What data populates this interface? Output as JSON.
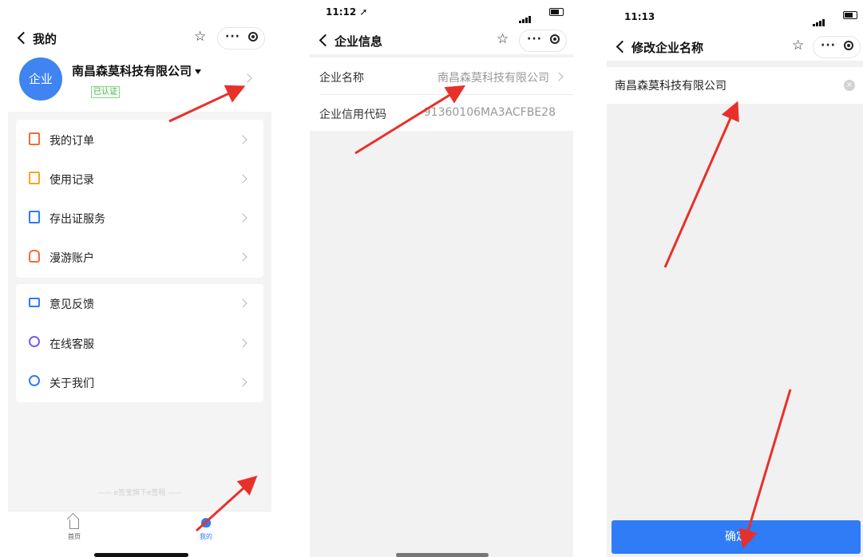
{
  "panel1": {
    "nav": {
      "back_label": "我的"
    },
    "company_name": "南昌森莫科技有限公司",
    "avatar_text": "企业",
    "verified_badge": "已认证",
    "menu_group_1": [
      {
        "label": "我的订单",
        "icon": "order-icon"
      },
      {
        "label": "使用记录",
        "icon": "record-icon"
      },
      {
        "label": "存出证服务",
        "icon": "certificate-icon"
      },
      {
        "label": "漫游账户",
        "icon": "money-bag-icon"
      }
    ],
    "menu_group_2": [
      {
        "label": "意见反馈",
        "icon": "mail-icon"
      },
      {
        "label": "在线客服",
        "icon": "headset-icon"
      },
      {
        "label": "关于我们",
        "icon": "info-icon"
      }
    ],
    "footer_note": "e签宝旗下e签租",
    "tabs": [
      {
        "label": "首页",
        "icon": "home-icon"
      },
      {
        "label": "我的",
        "icon": "person-icon"
      }
    ]
  },
  "panel2": {
    "time": "11:12 ➚",
    "nav": {
      "back_label": "企业信息"
    },
    "rows": [
      {
        "key": "企业名称",
        "value": "南昌森莫科技有限公司"
      },
      {
        "key": "企业信用代码",
        "value": "91360106MA3ACFBE28"
      }
    ]
  },
  "panel3": {
    "time": "11:13",
    "nav": {
      "back_label": "修改企业名称"
    },
    "input_value": "南昌森莫科技有限公司",
    "confirm_label": "确定"
  },
  "colors": {
    "accent": "#2f7cf6",
    "avatar": "#3f84f0",
    "annotation_arrow": "#e8302a",
    "verified": "#4caf50"
  }
}
